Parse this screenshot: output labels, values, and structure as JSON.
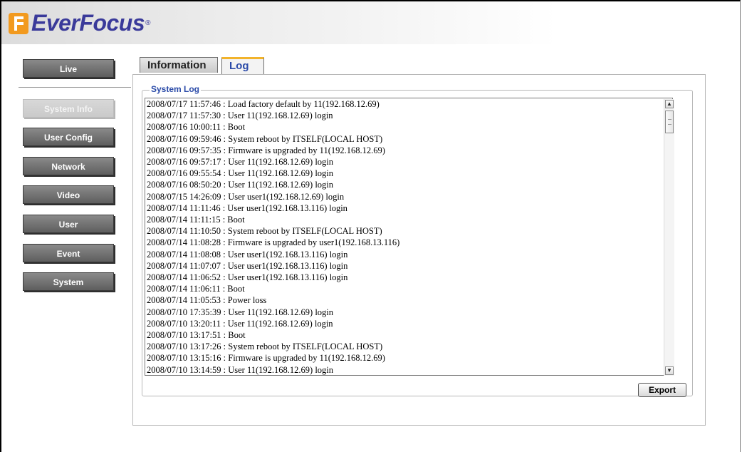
{
  "brand": {
    "name": "EverFocus",
    "mark": "®"
  },
  "nav": {
    "live": "Live",
    "items": [
      "System Info",
      "User Config",
      "Network",
      "Video",
      "User",
      "Event",
      "System"
    ]
  },
  "tabs": {
    "information": "Information",
    "log": "Log"
  },
  "system_log": {
    "legend": "System Log",
    "lines": [
      "2008/07/17 11:57:46 : Load factory default by 11(192.168.12.69)",
      "2008/07/17 11:57:30 : User 11(192.168.12.69) login",
      "2008/07/16 10:00:11 : Boot",
      "2008/07/16 09:59:46 : System reboot by ITSELF(LOCAL HOST)",
      "2008/07/16 09:57:35 : Firmware is upgraded by 11(192.168.12.69)",
      "2008/07/16 09:57:17 : User 11(192.168.12.69) login",
      "2008/07/16 09:55:54 : User 11(192.168.12.69) login",
      "2008/07/16 08:50:20 : User 11(192.168.12.69) login",
      "2008/07/15 14:26:09 : User user1(192.168.12.69) login",
      "2008/07/14 11:11:46 : User user1(192.168.13.116) login",
      "2008/07/14 11:11:15 : Boot",
      "2008/07/14 11:10:50 : System reboot by ITSELF(LOCAL HOST)",
      "2008/07/14 11:08:28 : Firmware is upgraded by user1(192.168.13.116)",
      "2008/07/14 11:08:08 : User user1(192.168.13.116) login",
      "2008/07/14 11:07:07 : User user1(192.168.13.116) login",
      "2008/07/14 11:06:52 : User user1(192.168.13.116) login",
      "2008/07/14 11:06:11 : Boot",
      "2008/07/14 11:05:53 : Power loss",
      "2008/07/10 17:35:39 : User 11(192.168.12.69) login",
      "2008/07/10 13:20:11 : User 11(192.168.12.69) login",
      "2008/07/10 13:17:51 : Boot",
      "2008/07/10 13:17:26 : System reboot by ITSELF(LOCAL HOST)",
      "2008/07/10 13:15:16 : Firmware is upgraded by 11(192.168.12.69)",
      "2008/07/10 13:14:59 : User 11(192.168.12.69) login"
    ]
  },
  "export_label": "Export",
  "icons": {
    "scroll_up": "up-arrow",
    "scroll_down": "down-arrow",
    "scroll_thumb": "grip"
  },
  "colors": {
    "brand_blue": "#3a3a9a",
    "brand_orange": "#f29a1f",
    "tab_accent": "#f2b32b",
    "legend_blue": "#2a4aa8"
  }
}
